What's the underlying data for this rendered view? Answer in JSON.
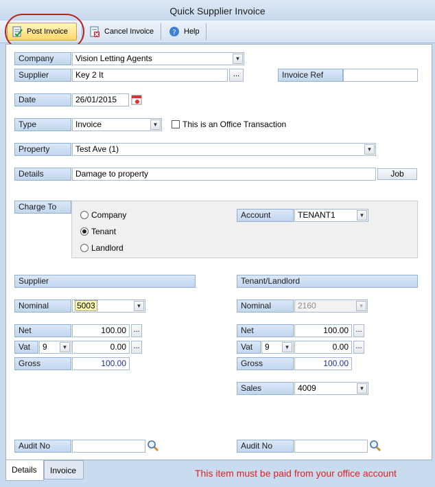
{
  "window": {
    "title": "Quick Supplier Invoice"
  },
  "toolbar": {
    "post": "Post Invoice",
    "cancel": "Cancel Invoice",
    "help": "Help"
  },
  "form": {
    "company_label": "Company",
    "company_value": "Vision Letting Agents",
    "supplier_label": "Supplier",
    "supplier_value": "Key 2 It",
    "invoice_ref_label": "Invoice Ref",
    "invoice_ref_value": "",
    "date_label": "Date",
    "date_value": "26/01/2015",
    "type_label": "Type",
    "type_value": "Invoice",
    "office_check_label": "This is an Office Transaction",
    "property_label": "Property",
    "property_value": "Test Ave (1)",
    "details_label": "Details",
    "details_value": "Damage to property",
    "job_button": "Job",
    "charge_to_label": "Charge To",
    "charge_options": [
      "Company",
      "Tenant",
      "Landlord"
    ],
    "charge_selected": "Tenant",
    "account_label": "Account",
    "account_value": "TENANT1"
  },
  "supplier_section": {
    "header": "Supplier",
    "nominal_label": "Nominal",
    "nominal_value": "5003",
    "net_label": "Net",
    "net_value": "100.00",
    "vat_label": "Vat",
    "vat_code": "9",
    "vat_value": "0.00",
    "gross_label": "Gross",
    "gross_value": "100.00",
    "audit_label": "Audit No",
    "audit_value": ""
  },
  "tenant_section": {
    "header": "Tenant/Landlord",
    "nominal_label": "Nominal",
    "nominal_value": "2160",
    "net_label": "Net",
    "net_value": "100.00",
    "vat_label": "Vat",
    "vat_code": "9",
    "vat_value": "0.00",
    "gross_label": "Gross",
    "gross_value": "100.00",
    "sales_label": "Sales",
    "sales_value": "4009",
    "audit_label": "Audit No",
    "audit_value": ""
  },
  "tabs": [
    "Details",
    "Invoice"
  ],
  "footer": {
    "message": "This item must be paid from your office account"
  },
  "colors": {
    "warning": "#e02020",
    "label_bg": "#c1d6f0",
    "highlight_ring": "#b82020"
  }
}
